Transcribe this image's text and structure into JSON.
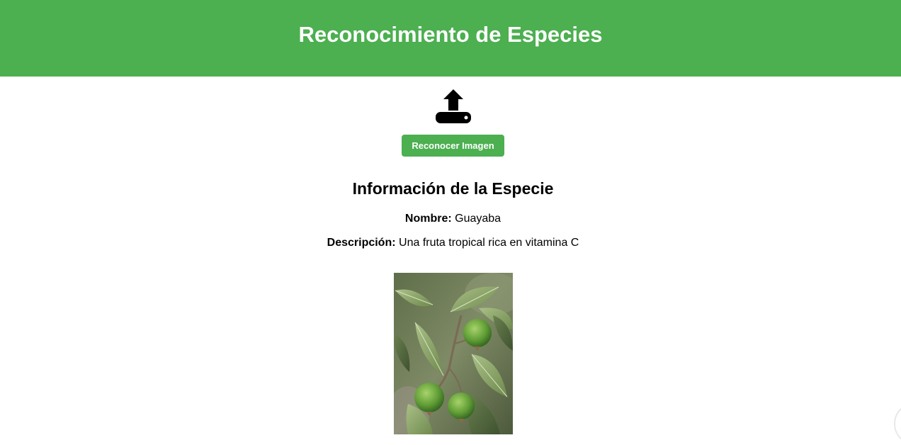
{
  "header": {
    "title": "Reconocimiento de Especies",
    "background": "#4caf50"
  },
  "upload": {
    "icon": "upload-icon"
  },
  "actions": {
    "recognize_label": "Reconocer Imagen",
    "accent": "#4caf50"
  },
  "species_info": {
    "title": "Información de la Especie",
    "name_label": "Nombre:",
    "name_value": "Guayaba",
    "description_label": "Descripción:",
    "description_value": "Una fruta tropical rica en vitamina C"
  },
  "photo": {
    "subject": "guava-branch-photo"
  }
}
